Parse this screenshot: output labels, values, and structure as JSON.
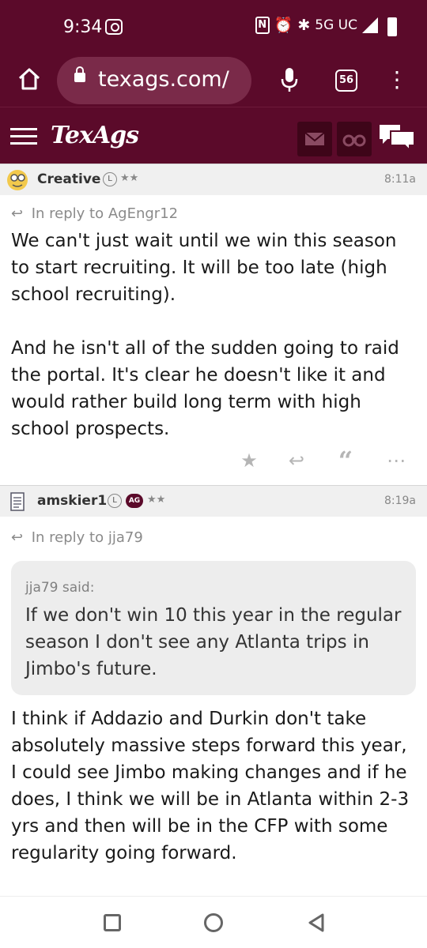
{
  "status": {
    "time": "9:34",
    "network": "5G UC"
  },
  "browser": {
    "url": "texags.com/",
    "tab_count": "56"
  },
  "site": {
    "logo": "TexAgs"
  },
  "posts": [
    {
      "username": "Creative",
      "badges": [
        "L"
      ],
      "stars": "★★",
      "time": "8:11a",
      "reply_to": "In reply to AgEngr12",
      "paragraphs": [
        "We can't just wait until we win this season to start recruiting. It will be too late (high school recruiting).",
        "And he isn't all of the sudden going to raid the portal. It's clear he doesn't like it and would rather build long term with high school prospects."
      ]
    },
    {
      "username": "amskier1",
      "badges": [
        "L",
        "AG"
      ],
      "stars": "★★",
      "time": "8:19a",
      "reply_to": "In reply to jja79",
      "quote_author": "jja79 said:",
      "quote_text": "If we don't win 10 this year in the regular season I don't see any Atlanta trips in Jimbo's future.",
      "paragraphs": [
        "I think if Addazio and Durkin don't take absolutely massive steps forward this year, I could see Jimbo making changes and if he does, I think we will be in Atlanta within 2-3 yrs and then will be in the CFP with some regularity going forward."
      ]
    }
  ],
  "actions": [
    "star-icon",
    "reply-icon",
    "quote-icon",
    "more-icon"
  ],
  "colors": {
    "maroon": "#5b0a2a",
    "header_dark": "#3e0519"
  }
}
